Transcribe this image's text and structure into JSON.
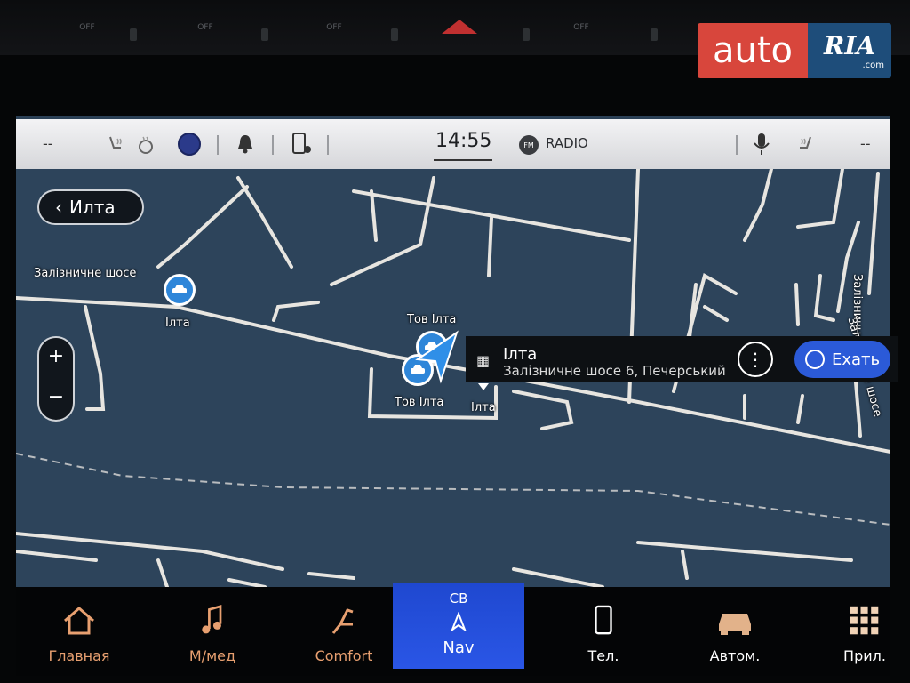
{
  "watermark": {
    "left": "auto",
    "right": "RIA",
    "domain": ".com"
  },
  "hardware_buttons": [
    "OFF",
    "OFF",
    "OFF",
    "OFF"
  ],
  "status_bar": {
    "left_dash": "--",
    "right_dash": "--",
    "clock": "14:55",
    "radio_badge": "FM",
    "radio_label": "RADIO"
  },
  "map": {
    "back_label": "Илта",
    "zoom_in": "+",
    "zoom_out": "−",
    "street_label": "Залізничне шосе",
    "vertical_street_label": "Залізничне шосе",
    "side_street_label": "Залізничне шосе",
    "poi_left_label": "Ілта",
    "poi_top_label": "Тов Ілта",
    "poi_bottom_label": "Тов Ілта",
    "poi_right_label": "Ілта"
  },
  "info_card": {
    "title": "Ілта",
    "address": "Залізничне шосе 6, Печерський",
    "more_label": "⋮",
    "go_label": "Ехать"
  },
  "nav_bar": {
    "items": [
      {
        "label": "Главная",
        "icon": "home-icon"
      },
      {
        "label": "М/мед",
        "icon": "music-note-icon"
      },
      {
        "label": "Comfort",
        "icon": "seat-icon"
      },
      {
        "label": "Nav",
        "icon": "navigation-arrow-icon",
        "heading": "СВ",
        "active": true
      },
      {
        "label": "Тел.",
        "icon": "phone-icon"
      },
      {
        "label": "Автом.",
        "icon": "car-icon"
      },
      {
        "label": "Прил.",
        "icon": "apps-grid-icon"
      }
    ]
  }
}
